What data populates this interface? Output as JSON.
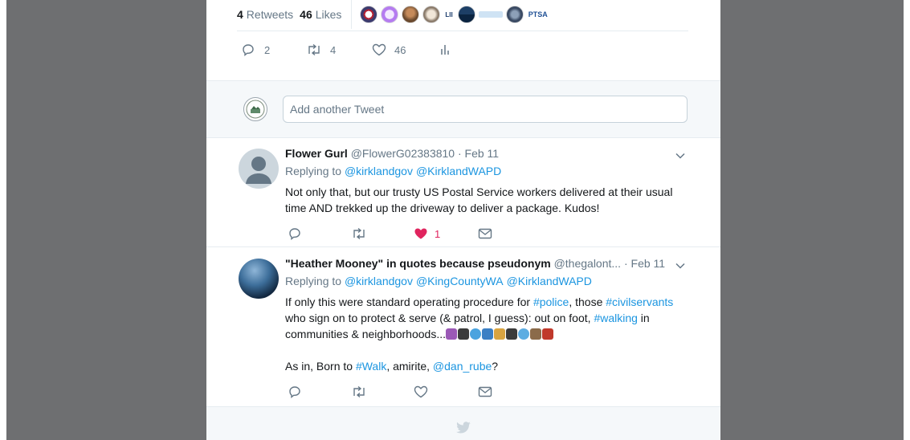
{
  "stats": {
    "retweets_count": "4",
    "retweets_label": "Retweets",
    "likes_count": "46",
    "likes_label": "Likes",
    "liker_avatar_icons": [
      "flag-avatar-icon",
      "egg-avatar-icon",
      "person-avatar-icon",
      "dog-avatar-icon",
      "logo-avatar-icon",
      "mountain-avatar-icon",
      "banner-avatar-icon",
      "seal-avatar-icon",
      "ptsa-avatar-icon"
    ]
  },
  "main_actions": {
    "reply_count": "2",
    "retweet_count": "4",
    "like_count": "46"
  },
  "composer": {
    "placeholder": "Add another Tweet"
  },
  "tweets": [
    {
      "name": "Flower Gurl",
      "handle": "@FlowerG02383810",
      "separator": "·",
      "time": "Feb 11",
      "replying_prefix": "Replying to",
      "replying_to": [
        "@kirklandgov",
        "@KirklandWAPD"
      ],
      "text": "Not only that, but our trusty US Postal Service workers delivered at their usual time AND trekked up the driveway to deliver a package.  Kudos!",
      "like_count": "1",
      "liked": true
    },
    {
      "name": "\"Heather Mooney\" in quotes because pseudonym",
      "handle": "@thegalont...",
      "separator": "·",
      "time": "Feb 11",
      "replying_prefix": "Replying to",
      "replying_to": [
        "@kirklandgov",
        "@KingCountyWA",
        "@KirklandWAPD"
      ],
      "text_1": "If only this were standard operating procedure for ",
      "hashtag_police": "#police",
      "text_2": ", those ",
      "hashtag_civil": "#civilservants",
      "text_3": " who sign on to protect & serve (& patrol, I guess): out on foot, ",
      "hashtag_walking": "#walking",
      "text_4": " in communities & neighborhoods...",
      "text_5": "As in, Born to ",
      "hashtag_walk": "#Walk",
      "text_6": ", amirite, ",
      "mention_dan": "@dan_rube",
      "text_7": "?",
      "like_count": "",
      "liked": false
    }
  ],
  "colors": {
    "link": "#1b95e0",
    "muted": "#657786",
    "like_red": "#e0245e",
    "gutter": "#6e6f71"
  }
}
